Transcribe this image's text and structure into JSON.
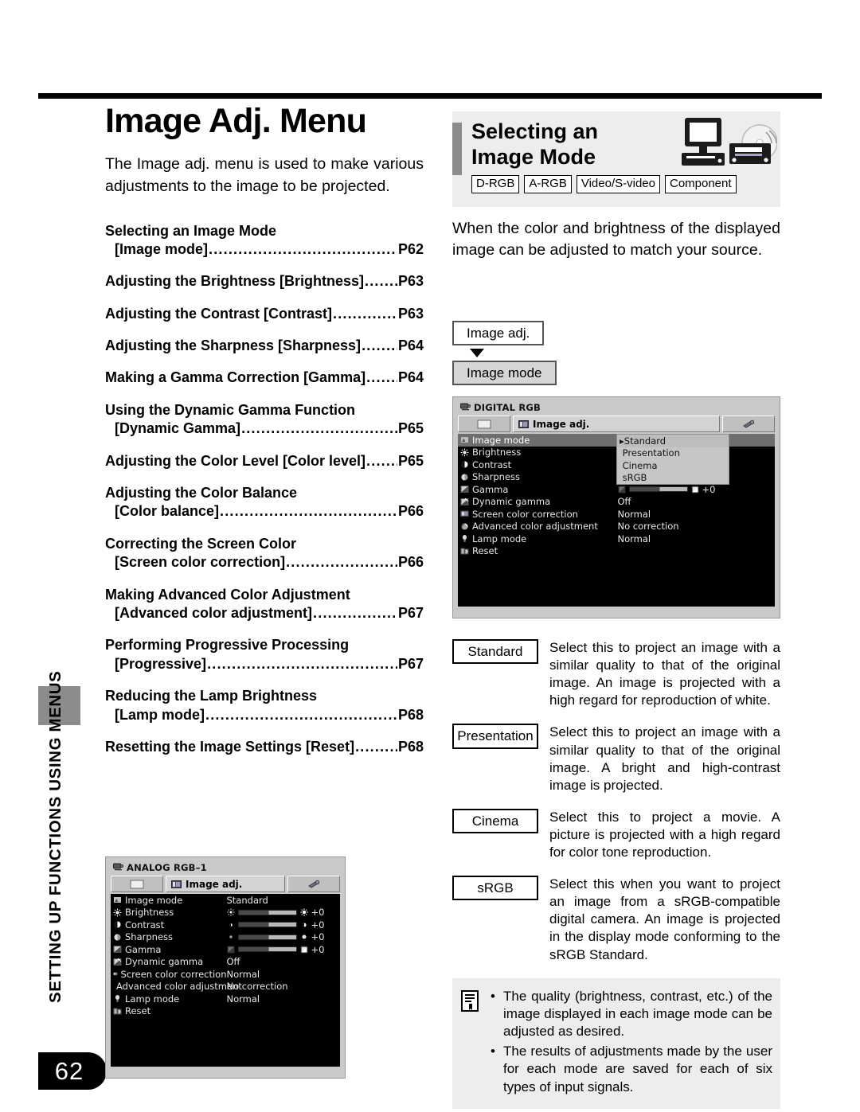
{
  "page": {
    "number": "62",
    "side_tab": "SETTING UP FUNCTIONS USING MENUS"
  },
  "left": {
    "title": "Image Adj. Menu",
    "intro": "The Image adj. menu is used to make various adjustments to the image to be projected.",
    "toc": [
      {
        "head": "Selecting an Image Mode",
        "sub": "[Image mode]",
        "page": "P62",
        "two_line": true
      },
      {
        "head": "Adjusting the Brightness [Brightness]",
        "sub": "",
        "page": "P63",
        "two_line": false
      },
      {
        "head": "Adjusting the Contrast [Contrast]",
        "sub": "",
        "page": "P63",
        "two_line": false
      },
      {
        "head": "Adjusting the Sharpness [Sharpness]",
        "sub": "",
        "page": "P64",
        "two_line": false
      },
      {
        "head": "Making a Gamma Correction [Gamma]",
        "sub": "",
        "page": "P64",
        "two_line": false
      },
      {
        "head": "Using the Dynamic Gamma Function",
        "sub": "[Dynamic Gamma]",
        "page": "P65",
        "two_line": true
      },
      {
        "head": "Adjusting the Color Level [Color level]",
        "sub": "",
        "page": "P65",
        "two_line": false
      },
      {
        "head": "Adjusting the Color Balance",
        "sub": "[Color balance]",
        "page": "P66",
        "two_line": true
      },
      {
        "head": "Correcting the Screen Color",
        "sub": "[Screen color correction]",
        "page": "P66",
        "two_line": true
      },
      {
        "head": "Making Advanced Color Adjustment",
        "sub": "[Advanced color adjustment]",
        "page": "P67",
        "two_line": true
      },
      {
        "head": "Performing Progressive Processing",
        "sub": "[Progressive]",
        "page": "P67",
        "two_line": true
      },
      {
        "head": "Reducing the Lamp Brightness",
        "sub": "[Lamp mode]",
        "page": "P68",
        "two_line": true
      },
      {
        "head": "Resetting the Image Settings [Reset]",
        "sub": "",
        "page": "P68",
        "two_line": false
      }
    ]
  },
  "right": {
    "section_title": "Selecting an Image Mode",
    "badges": [
      "D-RGB",
      "A-RGB",
      "Video/S-video",
      "Component"
    ],
    "lead": "When the color and brightness of the displayed image can be adjusted to match your source.",
    "crumbs": {
      "parent": "Image adj.",
      "child": "Image mode"
    },
    "modes": [
      {
        "key": "Standard",
        "desc": "Select this to project an image with a similar quality to that of the original image. An image is projected with a high regard for reproduction of white."
      },
      {
        "key": "Presentation",
        "desc": "Select this to project an image with a similar quality to that of the original image. A bright and high-contrast image is projected."
      },
      {
        "key": "Cinema",
        "desc": "Select this to project a movie. A picture is projected with a high regard for color tone reproduction."
      },
      {
        "key": "sRGB",
        "desc": "Select this when you want to project an image from a sRGB-compatible digital camera. An image is projected in the display mode conforming to the sRGB Standard."
      }
    ],
    "note": {
      "bullet": "•",
      "items": [
        "The quality (brightness, contrast, etc.) of the image displayed in each image mode can be adjusted as desired.",
        "The results of adjustments made by the user for each mode are saved for each of six types of input signals."
      ]
    }
  },
  "osd_digital": {
    "signal_title": "DIGITAL RGB",
    "tab_label": "Image adj.",
    "rows": [
      {
        "label": "Image mode",
        "value": "",
        "selected": true,
        "type": "text",
        "icon": "image-mode-icon"
      },
      {
        "label": "Brightness",
        "value": "",
        "selected": false,
        "type": "text",
        "icon": "brightness-icon"
      },
      {
        "label": "Contrast",
        "value": "",
        "selected": false,
        "type": "text",
        "icon": "contrast-icon"
      },
      {
        "label": "Sharpness",
        "value": "",
        "selected": false,
        "type": "text",
        "icon": "sharpness-icon"
      },
      {
        "label": "Gamma",
        "value": "+0",
        "selected": false,
        "type": "slider",
        "icon": "gamma-icon"
      },
      {
        "label": "Dynamic gamma",
        "value": "Off",
        "selected": false,
        "type": "text",
        "icon": "dynamic-gamma-icon"
      },
      {
        "label": "Screen color correction",
        "value": "Normal",
        "selected": false,
        "type": "text",
        "icon": "screen-color-icon"
      },
      {
        "label": "Advanced color adjustment",
        "value": "No correction",
        "selected": false,
        "type": "text",
        "icon": "advanced-color-icon"
      },
      {
        "label": "Lamp mode",
        "value": "Normal",
        "selected": false,
        "type": "text",
        "icon": "lamp-icon"
      },
      {
        "label": "Reset",
        "value": "",
        "selected": false,
        "type": "text",
        "icon": "reset-icon"
      }
    ],
    "dropdown": {
      "marker": "▸",
      "options": [
        "Standard",
        "Presentation",
        "Cinema",
        "sRGB"
      ],
      "selected": "Standard"
    }
  },
  "osd_analog": {
    "signal_title": "ANALOG RGB–1",
    "tab_label": "Image adj.",
    "rows": [
      {
        "label": "Image mode",
        "value": "Standard",
        "type": "text",
        "icon": "image-mode-icon"
      },
      {
        "label": "Brightness",
        "value": "+0",
        "type": "slider",
        "icon": "brightness-icon"
      },
      {
        "label": "Contrast",
        "value": "+0",
        "type": "slider",
        "icon": "contrast-icon"
      },
      {
        "label": "Sharpness",
        "value": "+0",
        "type": "slider",
        "icon": "sharpness-icon"
      },
      {
        "label": "Gamma",
        "value": "+0",
        "type": "slider",
        "icon": "gamma-icon"
      },
      {
        "label": "Dynamic gamma",
        "value": "Off",
        "type": "text",
        "icon": "dynamic-gamma-icon"
      },
      {
        "label": "Screen color correction",
        "value": "Normal",
        "type": "text",
        "icon": "screen-color-icon"
      },
      {
        "label": "Advanced color adjustment",
        "value": "No correction",
        "type": "text",
        "icon": "advanced-color-icon"
      },
      {
        "label": "Lamp mode",
        "value": "Normal",
        "type": "text",
        "icon": "lamp-icon"
      },
      {
        "label": "Reset",
        "value": "",
        "type": "text",
        "icon": "reset-icon"
      }
    ]
  }
}
